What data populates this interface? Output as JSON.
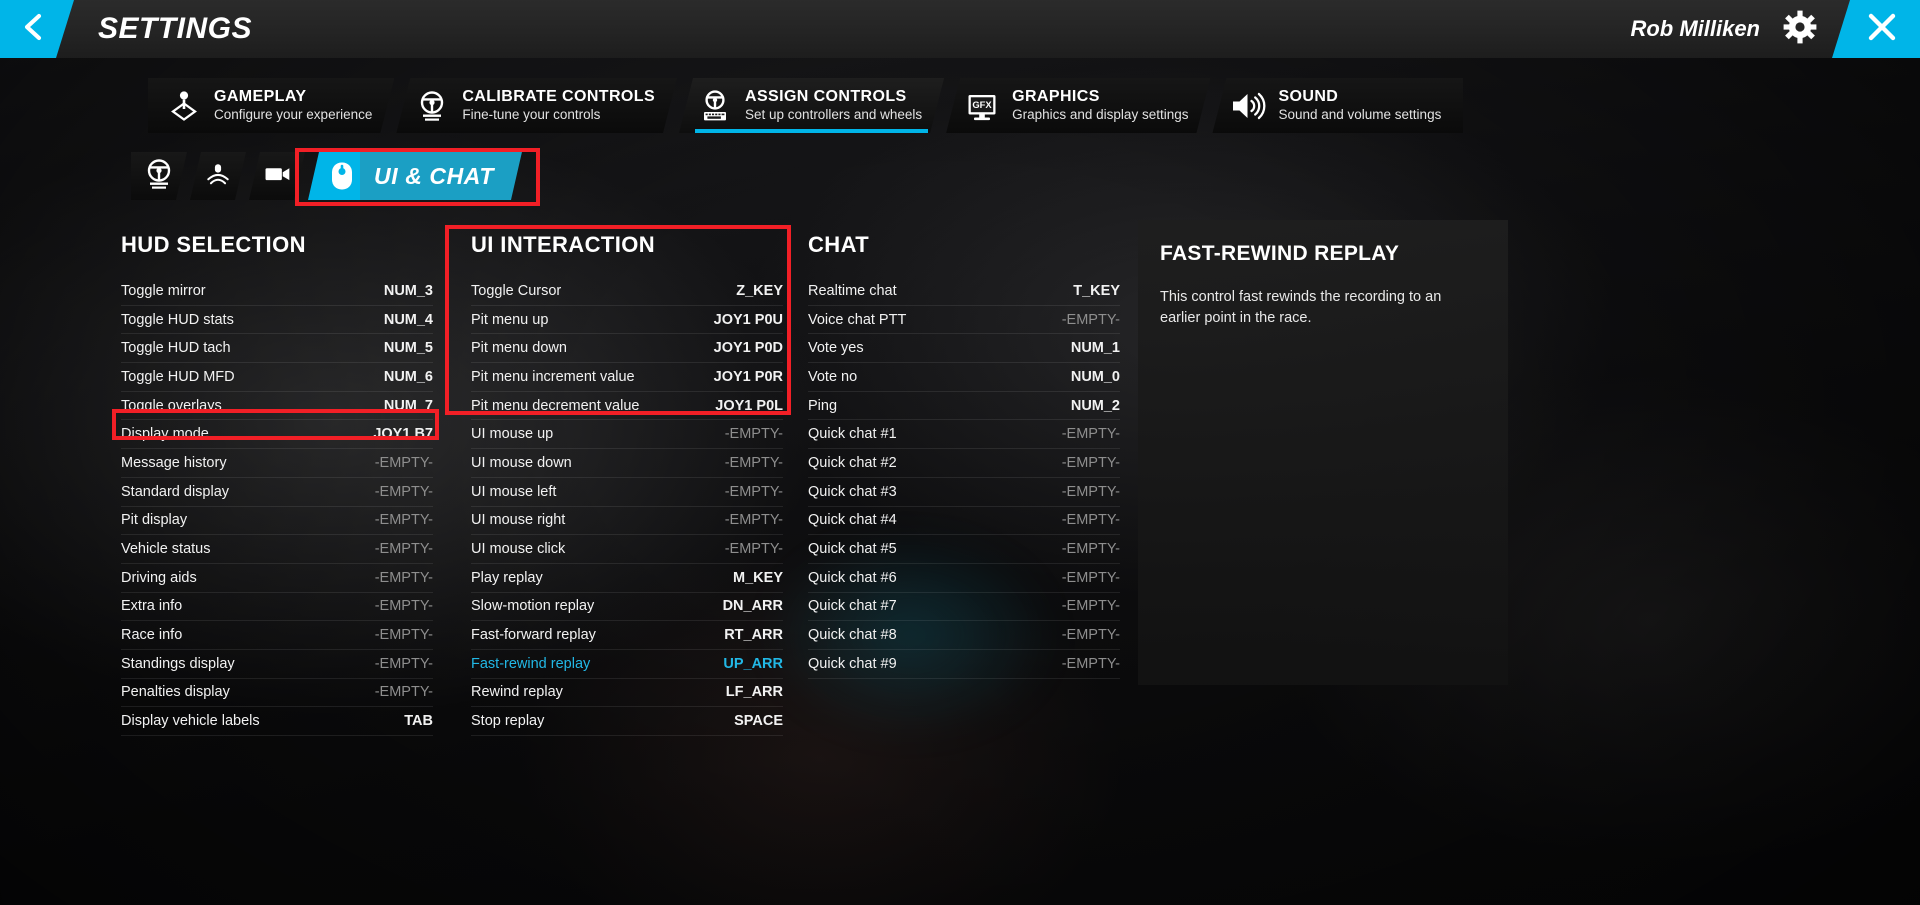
{
  "header": {
    "title": "SETTINGS",
    "user_name": "Rob Milliken",
    "back_icon": "chevron-left-icon",
    "gear_icon": "gear-icon",
    "close_icon": "close-icon",
    "accent_color": "#00b5e8"
  },
  "main_tabs": [
    {
      "title": "GAMEPLAY",
      "subtitle": "Configure your experience",
      "icon": "joystick-icon",
      "active": false
    },
    {
      "title": "CALIBRATE CONTROLS",
      "subtitle": "Fine-tune your controls",
      "icon": "steering-wheel-icon",
      "active": false
    },
    {
      "title": "ASSIGN CONTROLS",
      "subtitle": "Set up controllers and wheels",
      "icon": "wheel-keyboard-icon",
      "active": true
    },
    {
      "title": "GRAPHICS",
      "subtitle": "Graphics and display settings",
      "icon": "gfx-monitor-icon",
      "active": false
    },
    {
      "title": "SOUND",
      "subtitle": "Sound and volume settings",
      "icon": "speaker-icon",
      "active": false
    }
  ],
  "sub_tabs": [
    {
      "label": "",
      "icon": "steering-wheel-icon",
      "active": false
    },
    {
      "label": "",
      "icon": "pedals-icon",
      "active": false
    },
    {
      "label": "",
      "icon": "camera-icon",
      "active": false
    },
    {
      "label": "UI & CHAT",
      "icon": "mouse-icon",
      "active": true
    }
  ],
  "columns": [
    {
      "heading": "HUD SELECTION",
      "rows": [
        {
          "label": "Toggle mirror",
          "value": "NUM_3",
          "empty": false,
          "selected": false
        },
        {
          "label": "Toggle HUD stats",
          "value": "NUM_4",
          "empty": false,
          "selected": false
        },
        {
          "label": "Toggle HUD tach",
          "value": "NUM_5",
          "empty": false,
          "selected": false
        },
        {
          "label": "Toggle HUD MFD",
          "value": "NUM_6",
          "empty": false,
          "selected": false
        },
        {
          "label": "Toggle overlays",
          "value": "NUM_7",
          "empty": false,
          "selected": false
        },
        {
          "label": "Display mode",
          "value": "JOY1 B7",
          "empty": false,
          "selected": false
        },
        {
          "label": "Message history",
          "value": "-EMPTY-",
          "empty": true,
          "selected": false
        },
        {
          "label": "Standard display",
          "value": "-EMPTY-",
          "empty": true,
          "selected": false
        },
        {
          "label": "Pit display",
          "value": "-EMPTY-",
          "empty": true,
          "selected": false
        },
        {
          "label": "Vehicle status",
          "value": "-EMPTY-",
          "empty": true,
          "selected": false
        },
        {
          "label": "Driving aids",
          "value": "-EMPTY-",
          "empty": true,
          "selected": false
        },
        {
          "label": "Extra info",
          "value": "-EMPTY-",
          "empty": true,
          "selected": false
        },
        {
          "label": "Race info",
          "value": "-EMPTY-",
          "empty": true,
          "selected": false
        },
        {
          "label": "Standings display",
          "value": "-EMPTY-",
          "empty": true,
          "selected": false
        },
        {
          "label": "Penalties display",
          "value": "-EMPTY-",
          "empty": true,
          "selected": false
        },
        {
          "label": "Display vehicle labels",
          "value": "TAB",
          "empty": false,
          "selected": false
        }
      ]
    },
    {
      "heading": "UI INTERACTION",
      "rows": [
        {
          "label": "Toggle Cursor",
          "value": "Z_KEY",
          "empty": false,
          "selected": false
        },
        {
          "label": "Pit menu up",
          "value": "JOY1 P0U",
          "empty": false,
          "selected": false
        },
        {
          "label": "Pit menu down",
          "value": "JOY1 P0D",
          "empty": false,
          "selected": false
        },
        {
          "label": "Pit menu increment value",
          "value": "JOY1 P0R",
          "empty": false,
          "selected": false
        },
        {
          "label": "Pit menu decrement value",
          "value": "JOY1 P0L",
          "empty": false,
          "selected": false
        },
        {
          "label": "UI mouse up",
          "value": "-EMPTY-",
          "empty": true,
          "selected": false
        },
        {
          "label": "UI mouse down",
          "value": "-EMPTY-",
          "empty": true,
          "selected": false
        },
        {
          "label": "UI mouse left",
          "value": "-EMPTY-",
          "empty": true,
          "selected": false
        },
        {
          "label": "UI mouse right",
          "value": "-EMPTY-",
          "empty": true,
          "selected": false
        },
        {
          "label": "UI mouse click",
          "value": "-EMPTY-",
          "empty": true,
          "selected": false
        },
        {
          "label": "Play replay",
          "value": "M_KEY",
          "empty": false,
          "selected": false
        },
        {
          "label": "Slow-motion replay",
          "value": "DN_ARR",
          "empty": false,
          "selected": false
        },
        {
          "label": "Fast-forward replay",
          "value": "RT_ARR",
          "empty": false,
          "selected": false
        },
        {
          "label": "Fast-rewind replay",
          "value": "UP_ARR",
          "empty": false,
          "selected": true
        },
        {
          "label": "Rewind replay",
          "value": "LF_ARR",
          "empty": false,
          "selected": false
        },
        {
          "label": "Stop replay",
          "value": "SPACE",
          "empty": false,
          "selected": false
        }
      ]
    },
    {
      "heading": "CHAT",
      "rows": [
        {
          "label": "Realtime chat",
          "value": "T_KEY",
          "empty": false,
          "selected": false
        },
        {
          "label": "Voice chat PTT",
          "value": "-EMPTY-",
          "empty": true,
          "selected": false
        },
        {
          "label": "Vote yes",
          "value": "NUM_1",
          "empty": false,
          "selected": false
        },
        {
          "label": "Vote no",
          "value": "NUM_0",
          "empty": false,
          "selected": false
        },
        {
          "label": "Ping",
          "value": "NUM_2",
          "empty": false,
          "selected": false
        },
        {
          "label": "Quick chat #1",
          "value": "-EMPTY-",
          "empty": true,
          "selected": false
        },
        {
          "label": "Quick chat #2",
          "value": "-EMPTY-",
          "empty": true,
          "selected": false
        },
        {
          "label": "Quick chat #3",
          "value": "-EMPTY-",
          "empty": true,
          "selected": false
        },
        {
          "label": "Quick chat #4",
          "value": "-EMPTY-",
          "empty": true,
          "selected": false
        },
        {
          "label": "Quick chat #5",
          "value": "-EMPTY-",
          "empty": true,
          "selected": false
        },
        {
          "label": "Quick chat #6",
          "value": "-EMPTY-",
          "empty": true,
          "selected": false
        },
        {
          "label": "Quick chat #7",
          "value": "-EMPTY-",
          "empty": true,
          "selected": false
        },
        {
          "label": "Quick chat #8",
          "value": "-EMPTY-",
          "empty": true,
          "selected": false
        },
        {
          "label": "Quick chat #9",
          "value": "-EMPTY-",
          "empty": true,
          "selected": false
        }
      ]
    }
  ],
  "info_panel": {
    "title": "FAST-REWIND REPLAY",
    "description": "This control fast rewinds the recording to an earlier point in the race."
  },
  "annotations": {
    "highlight_color": "#f21f26",
    "boxes": [
      "ui-and-chat-tab",
      "display-mode-row",
      "ui-interaction-group"
    ]
  }
}
